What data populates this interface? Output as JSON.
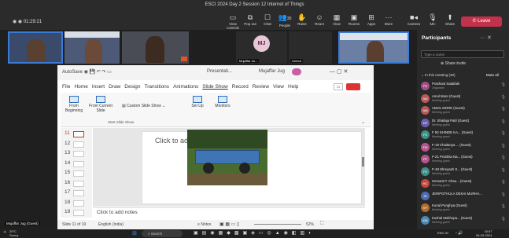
{
  "window": {
    "title": "ESCI 2024 Day 2 Session 12 Internet of Things",
    "timer": "01:29:21"
  },
  "toolbar": [
    {
      "label": "View controls",
      "icon": "layout-icon"
    },
    {
      "label": "Pop out",
      "icon": "popout-icon"
    },
    {
      "label": "Chat",
      "icon": "chat-icon"
    },
    {
      "label": "People",
      "icon": "people-icon",
      "count": "30"
    },
    {
      "label": "Raise",
      "icon": "hand-icon"
    },
    {
      "label": "React",
      "icon": "react-icon"
    },
    {
      "label": "View",
      "icon": "view-icon"
    },
    {
      "label": "Rooms",
      "icon": "rooms-icon"
    },
    {
      "label": "Apps",
      "icon": "apps-icon"
    },
    {
      "label": "More",
      "icon": "more-icon"
    },
    {
      "label": "Camera",
      "icon": "camera-icon"
    },
    {
      "label": "Mic",
      "icon": "mic-icon"
    },
    {
      "label": "Share",
      "icon": "share-icon"
    }
  ],
  "leave_label": "Leave",
  "tiles": [
    {
      "name": ""
    },
    {
      "name": ""
    },
    {
      "name": ""
    },
    {
      "initials": "MJ",
      "name": "Mujaffar Ja..."
    },
    {
      "name": "Unmut"
    },
    {
      "name": ""
    }
  ],
  "panel": {
    "title": "Participants",
    "search_placeholder": "Type a name",
    "share_invite": "Share invite",
    "in_meeting": "In this meeting (30)",
    "mute_all": "Mute all",
    "people": [
      {
        "initials": "PS",
        "name": "Prashant Sadafule",
        "role": "Organiser",
        "color": "#a14f87"
      },
      {
        "initials": "AM",
        "name": "Amol More (Guest)",
        "role": "Meeting guest",
        "color": "#b55a5a"
      },
      {
        "initials": "AM",
        "name": "AMOL MORE (Guest)",
        "role": "Meeting guest",
        "color": "#b55a5a"
      },
      {
        "initials": "DP",
        "name": "Dr. Shailaja Patil (Guest)",
        "role": "Meeting guest",
        "color": "#6a5fb0"
      },
      {
        "initials": "FS",
        "name": "F 50 SHINDE KA... (Guest)",
        "role": "Meeting guest",
        "color": "#3f8f87"
      },
      {
        "initials": "FM",
        "name": "F-19 Chaitanya ... (Guest)",
        "role": "Meeting guest",
        "color": "#b5548c"
      },
      {
        "initials": "FP",
        "name": "F-21 Prashita Na... (Guest)",
        "role": "Meeting guest",
        "color": "#b5548c"
      },
      {
        "initials": "FS",
        "name": "F-48 Shreyash S... (Guest)",
        "role": "Meeting guest",
        "color": "#3f8f87"
      },
      {
        "initials": "HC",
        "name": "Hemant P. Chau... (Guest)",
        "role": "Meeting guest",
        "color": "#c04b3d"
      },
      {
        "initials": "JD",
        "name": "JERIPOTHULA DESAI MURHA...",
        "role": "",
        "color": "#4d6cb0"
      },
      {
        "initials": "KP",
        "name": "Kunal Punghya (Guest)",
        "role": "Meeting guest",
        "color": "#b56b2d"
      },
      {
        "initials": "KM",
        "name": "Kushal Mukhopa... (Guest)",
        "role": "Meeting guest",
        "color": "#4d8ab0"
      }
    ]
  },
  "ppt": {
    "title_autosave": "AutoSave",
    "file_name": "Presentati...",
    "search": "Mujaffar Jug",
    "menu": [
      "File",
      "Home",
      "Insert",
      "Draw",
      "Design",
      "Transitions",
      "Animations",
      "Slide Show",
      "Record",
      "Review",
      "View",
      "Help"
    ],
    "ribbon": {
      "from_beginning": "From Beginning",
      "from_current": "From Current Slide",
      "custom": "Custom Slide Show",
      "setup": "Set Up",
      "monitors": "Monitors",
      "group": "Start Slide Show"
    },
    "slide_numbers": [
      "11",
      "12",
      "13",
      "14",
      "15",
      "16",
      "17",
      "18",
      "19"
    ],
    "click_title": "Click to add title",
    "click_notes": "Click to add notes",
    "status": {
      "slide": "Slide 11 of 19",
      "lang": "English (India)",
      "notes": "Notes",
      "zoom": "52%"
    }
  },
  "self": {
    "name": "Mujaffar Jug (Guest)"
  },
  "taskbar": {
    "search": "Search",
    "temp": "29°C",
    "weather": "Sunny",
    "lang": "ENG IN",
    "time": "15:07",
    "date": "06-03-2024"
  }
}
